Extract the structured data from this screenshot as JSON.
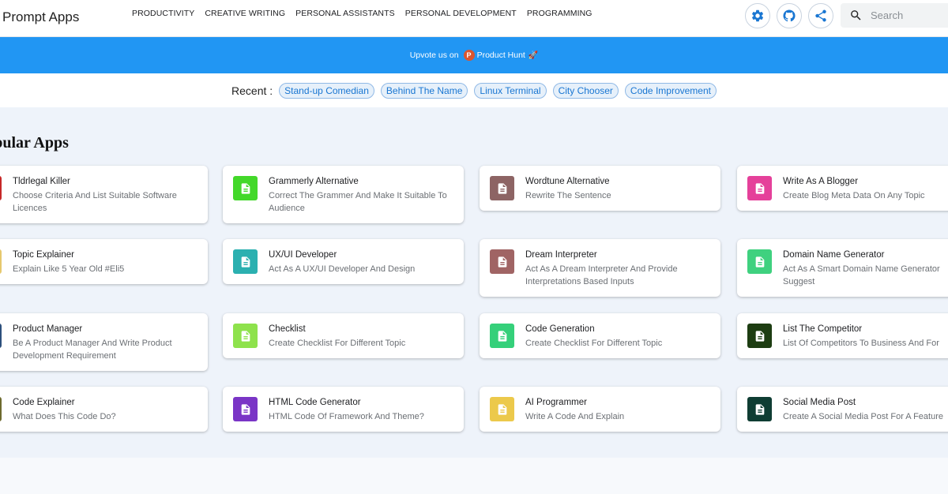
{
  "header": {
    "brand": "Prompt Apps",
    "nav": [
      "PRODUCTIVITY",
      "CREATIVE WRITING",
      "PERSONAL ASSISTANTS",
      "PERSONAL DEVELOPMENT",
      "PROGRAMMING"
    ],
    "search_placeholder": "Search",
    "icons": [
      "gear-icon",
      "github-icon",
      "share-icon",
      "search-icon"
    ]
  },
  "banner": {
    "text": "Upvote us on",
    "logo_letter": "P",
    "link": "Product Hunt",
    "emoji": "🚀"
  },
  "recent": {
    "label": "Recent :",
    "items": [
      "Stand-up Comedian",
      "Behind The Name",
      "Linux Terminal",
      "City Chooser",
      "Code Improvement"
    ]
  },
  "main": {
    "title": "Popular Apps",
    "cards": [
      {
        "title": "Tldrlegal Killer",
        "desc": "Choose Criteria And List Suitable Software Licences",
        "color": "#c62828"
      },
      {
        "title": "Grammerly Alternative",
        "desc": "Correct The Grammer And Make It Suitable To Audience",
        "color": "#43d82a"
      },
      {
        "title": "Wordtune Alternative",
        "desc": "Rewrite The Sentence",
        "color": "#8d6464"
      },
      {
        "title": "Write As A Blogger",
        "desc": "Create Blog Meta Data On Any Topic",
        "color": "#e5409a"
      },
      {
        "title": "Topic Explainer",
        "desc": "Explain Like 5 Year Old #Eli5",
        "color": "#e6c86e"
      },
      {
        "title": "UX/UI Developer",
        "desc": "Act As A UX/UI Developer And Design",
        "color": "#2bb0b0"
      },
      {
        "title": "Dream Interpreter",
        "desc": "Act As A Dream Interpreter And Provide Interpretations Based Inputs",
        "color": "#a06464"
      },
      {
        "title": "Domain Name Generator",
        "desc": "Act As A Smart Domain Name Generator Suggest",
        "color": "#3fd17f"
      },
      {
        "title": "Product Manager",
        "desc": "Be A Product Manager And Write Product Development Requirement",
        "color": "#2c4f7c"
      },
      {
        "title": "Checklist",
        "desc": "Create Checklist For Different Topic",
        "color": "#8ee24c"
      },
      {
        "title": "Code Generation",
        "desc": "Create Checklist For Different Topic",
        "color": "#35d07a"
      },
      {
        "title": "List The Competitor",
        "desc": "List Of Competitors To Business And For",
        "color": "#1d3d12"
      },
      {
        "title": "Code Explainer",
        "desc": "What Does This Code Do?",
        "color": "#6d6a2e"
      },
      {
        "title": "HTML Code Generator",
        "desc": "HTML Code Of Framework And Theme?",
        "color": "#7a35c6"
      },
      {
        "title": "AI Programmer",
        "desc": "Write A Code And Explain",
        "color": "#ecc94b"
      },
      {
        "title": "Social Media Post",
        "desc": "Create A Social Media Post For A Feature",
        "color": "#0f3d33"
      }
    ]
  }
}
